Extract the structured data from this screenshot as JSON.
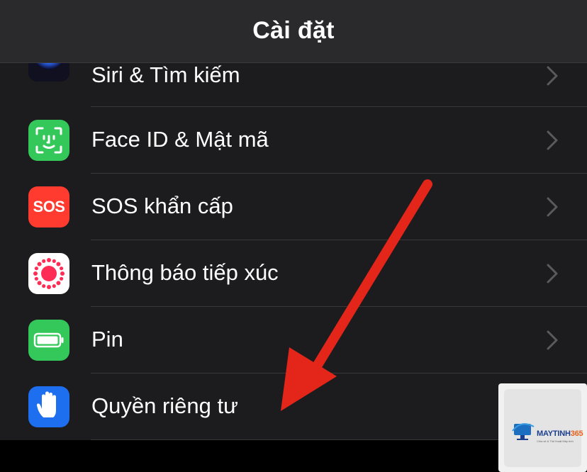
{
  "navbar": {
    "title": "Cài đặt"
  },
  "rows": [
    {
      "label": "Siri & Tìm kiếm",
      "icon": "siri-icon"
    },
    {
      "label": "Face ID & Mật mã",
      "icon": "face-id-icon"
    },
    {
      "label": "SOS khẩn cấp",
      "icon": "sos-icon",
      "icon_text": "SOS"
    },
    {
      "label": "Thông báo tiếp xúc",
      "icon": "exposure-notification-icon"
    },
    {
      "label": "Pin",
      "icon": "battery-icon"
    },
    {
      "label": "Quyền riêng tư",
      "icon": "privacy-hand-icon"
    }
  ],
  "watermark": {
    "brand_main": "MAYTINH",
    "brand_num": "365",
    "tagline": "Chia sẻ & Thủ thuật Máy tính"
  },
  "colors": {
    "background": "#1c1c1e",
    "separator": "#38383a",
    "face_id_green": "#34c759",
    "sos_red": "#ff3b30",
    "battery_green": "#34c759",
    "privacy_blue": "#1e6ef0",
    "arrow_red": "#e32619"
  }
}
